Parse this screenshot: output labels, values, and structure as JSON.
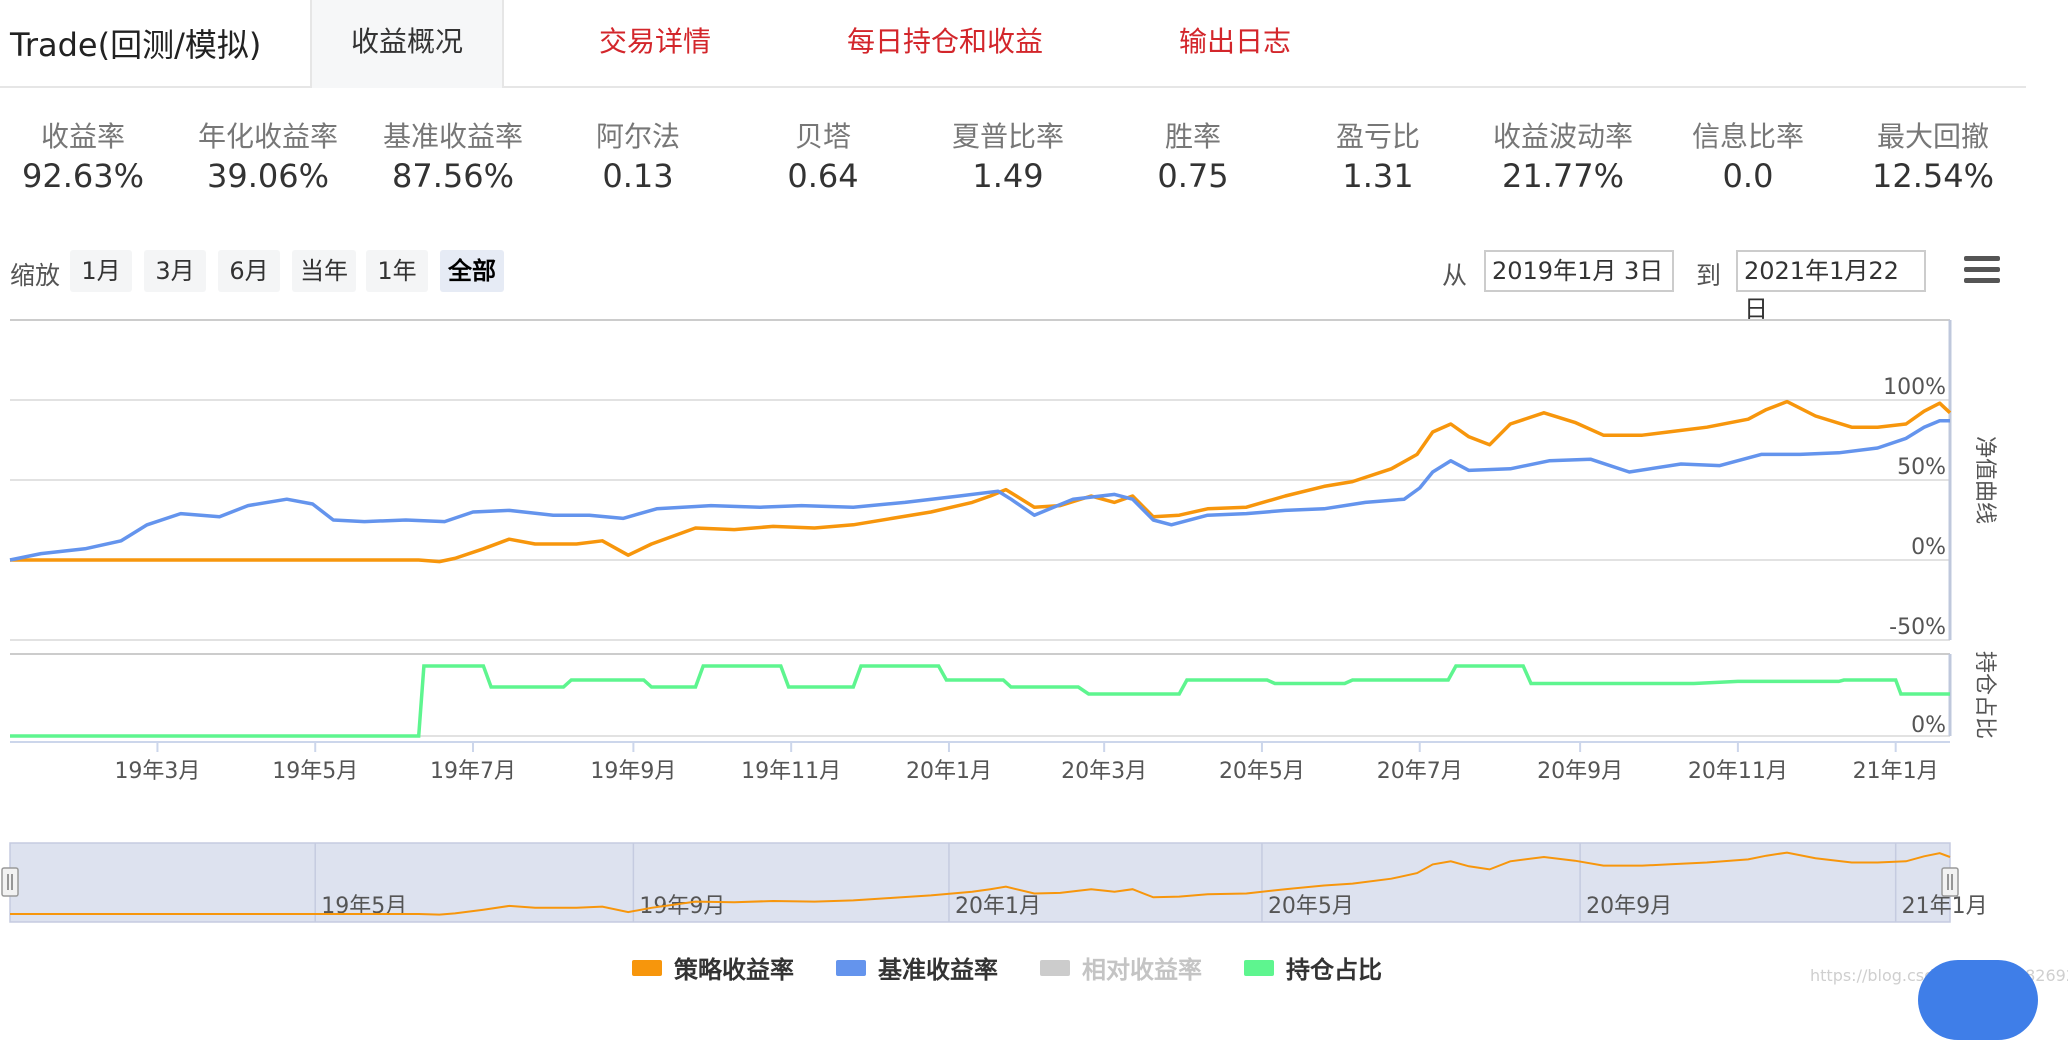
{
  "app_title": "Trade(回测/模拟)",
  "tabs": [
    {
      "label": "收益概况",
      "active": true
    },
    {
      "label": "交易详情",
      "active": false
    },
    {
      "label": "每日持仓和收益",
      "active": false
    },
    {
      "label": "输出日志",
      "active": false
    }
  ],
  "metrics": [
    {
      "label": "收益率",
      "value": "92.63%"
    },
    {
      "label": "年化收益率",
      "value": "39.06%"
    },
    {
      "label": "基准收益率",
      "value": "87.56%"
    },
    {
      "label": "阿尔法",
      "value": "0.13"
    },
    {
      "label": "贝塔",
      "value": "0.64"
    },
    {
      "label": "夏普比率",
      "value": "1.49"
    },
    {
      "label": "胜率",
      "value": "0.75"
    },
    {
      "label": "盈亏比",
      "value": "1.31"
    },
    {
      "label": "收益波动率",
      "value": "21.77%"
    },
    {
      "label": "信息比率",
      "value": "0.0"
    },
    {
      "label": "最大回撤",
      "value": "12.54%"
    }
  ],
  "zoom": {
    "label": "缩放",
    "buttons": [
      "1月",
      "3月",
      "6月",
      "当年",
      "1年",
      "全部"
    ],
    "selected": "全部"
  },
  "range": {
    "from_label": "从",
    "from": "2019年1月 3日",
    "to_label": "到",
    "to": "2021年1月22日"
  },
  "colors": {
    "strategy": "#f7960c",
    "benchmark": "#6494ed",
    "relative": "#cccccc",
    "position": "#5ef58f",
    "tab_link": "#d3262b"
  },
  "watermark": "https://blog.csdn.net/m0_58269290",
  "chart_data": {
    "type": "line",
    "x_range": [
      "2019-01-03",
      "2021-01-22"
    ],
    "x_ticks": [
      {
        "date": "2019-03-01",
        "label": "19年3月"
      },
      {
        "date": "2019-05-01",
        "label": "19年5月"
      },
      {
        "date": "2019-07-01",
        "label": "19年7月"
      },
      {
        "date": "2019-09-01",
        "label": "19年9月"
      },
      {
        "date": "2019-11-01",
        "label": "19年11月"
      },
      {
        "date": "2020-01-01",
        "label": "20年1月"
      },
      {
        "date": "2020-03-01",
        "label": "20年3月"
      },
      {
        "date": "2020-05-01",
        "label": "20年5月"
      },
      {
        "date": "2020-07-01",
        "label": "20年7月"
      },
      {
        "date": "2020-09-01",
        "label": "20年9月"
      },
      {
        "date": "2020-11-01",
        "label": "20年11月"
      },
      {
        "date": "2021-01-01",
        "label": "21年1月"
      }
    ],
    "navigator_ticks": [
      {
        "date": "2019-05-01",
        "label": "19年5月"
      },
      {
        "date": "2019-09-01",
        "label": "19年9月"
      },
      {
        "date": "2020-01-01",
        "label": "20年1月"
      },
      {
        "date": "2020-05-01",
        "label": "20年5月"
      },
      {
        "date": "2020-09-01",
        "label": "20年9月"
      },
      {
        "date": "2021-01-01",
        "label": "21年1月"
      }
    ],
    "navigator_handles": [
      "2019-01-03",
      "2021-01-22"
    ],
    "main_panel": {
      "ylabel": "净值曲线",
      "ylim": [
        -50,
        150
      ],
      "yticks": [
        {
          "v": 100,
          "label": "100%"
        },
        {
          "v": 50,
          "label": "50%"
        },
        {
          "v": 0,
          "label": "0%"
        },
        {
          "v": -50,
          "label": "-50%"
        }
      ],
      "series": [
        {
          "name": "策略收益率",
          "color_key": "strategy",
          "points": [
            [
              "2019-01-03",
              0
            ],
            [
              "2019-02-15",
              0
            ],
            [
              "2019-04-01",
              0
            ],
            [
              "2019-06-10",
              0
            ],
            [
              "2019-06-18",
              -1
            ],
            [
              "2019-06-24",
              1
            ],
            [
              "2019-07-05",
              7
            ],
            [
              "2019-07-15",
              13
            ],
            [
              "2019-07-25",
              10
            ],
            [
              "2019-08-10",
              10
            ],
            [
              "2019-08-20",
              12
            ],
            [
              "2019-08-30",
              3
            ],
            [
              "2019-09-08",
              10
            ],
            [
              "2019-09-25",
              20
            ],
            [
              "2019-10-10",
              19
            ],
            [
              "2019-10-25",
              21
            ],
            [
              "2019-11-10",
              20
            ],
            [
              "2019-11-25",
              22
            ],
            [
              "2019-12-10",
              26
            ],
            [
              "2019-12-25",
              30
            ],
            [
              "2020-01-10",
              36
            ],
            [
              "2020-01-17",
              40
            ],
            [
              "2020-01-23",
              44
            ],
            [
              "2020-02-03",
              33
            ],
            [
              "2020-02-13",
              34
            ],
            [
              "2020-02-25",
              40
            ],
            [
              "2020-03-05",
              36
            ],
            [
              "2020-03-12",
              40
            ],
            [
              "2020-03-20",
              27
            ],
            [
              "2020-03-30",
              28
            ],
            [
              "2020-04-10",
              32
            ],
            [
              "2020-04-25",
              33
            ],
            [
              "2020-05-10",
              40
            ],
            [
              "2020-05-25",
              46
            ],
            [
              "2020-06-05",
              49
            ],
            [
              "2020-06-20",
              57
            ],
            [
              "2020-06-30",
              66
            ],
            [
              "2020-07-06",
              80
            ],
            [
              "2020-07-13",
              85
            ],
            [
              "2020-07-20",
              77
            ],
            [
              "2020-07-28",
              72
            ],
            [
              "2020-08-05",
              85
            ],
            [
              "2020-08-18",
              92
            ],
            [
              "2020-08-30",
              86
            ],
            [
              "2020-09-10",
              78
            ],
            [
              "2020-09-25",
              78
            ],
            [
              "2020-10-05",
              80
            ],
            [
              "2020-10-20",
              83
            ],
            [
              "2020-11-05",
              88
            ],
            [
              "2020-11-12",
              94
            ],
            [
              "2020-11-20",
              99
            ],
            [
              "2020-12-01",
              90
            ],
            [
              "2020-12-15",
              83
            ],
            [
              "2020-12-25",
              83
            ],
            [
              "2021-01-05",
              85
            ],
            [
              "2021-01-12",
              93
            ],
            [
              "2021-01-18",
              98
            ],
            [
              "2021-01-22",
              92
            ]
          ]
        },
        {
          "name": "基准收益率",
          "color_key": "benchmark",
          "points": [
            [
              "2019-01-03",
              0
            ],
            [
              "2019-01-15",
              4
            ],
            [
              "2019-02-01",
              7
            ],
            [
              "2019-02-15",
              12
            ],
            [
              "2019-02-25",
              22
            ],
            [
              "2019-03-10",
              29
            ],
            [
              "2019-03-25",
              27
            ],
            [
              "2019-04-05",
              34
            ],
            [
              "2019-04-20",
              38
            ],
            [
              "2019-04-30",
              35
            ],
            [
              "2019-05-08",
              25
            ],
            [
              "2019-05-20",
              24
            ],
            [
              "2019-06-05",
              25
            ],
            [
              "2019-06-20",
              24
            ],
            [
              "2019-07-01",
              30
            ],
            [
              "2019-07-15",
              31
            ],
            [
              "2019-08-01",
              28
            ],
            [
              "2019-08-15",
              28
            ],
            [
              "2019-08-28",
              26
            ],
            [
              "2019-09-10",
              32
            ],
            [
              "2019-10-01",
              34
            ],
            [
              "2019-10-20",
              33
            ],
            [
              "2019-11-05",
              34
            ],
            [
              "2019-11-25",
              33
            ],
            [
              "2019-12-15",
              36
            ],
            [
              "2020-01-05",
              40
            ],
            [
              "2020-01-20",
              43
            ],
            [
              "2020-01-25",
              38
            ],
            [
              "2020-02-03",
              28
            ],
            [
              "2020-02-18",
              38
            ],
            [
              "2020-03-05",
              41
            ],
            [
              "2020-03-12",
              38
            ],
            [
              "2020-03-20",
              25
            ],
            [
              "2020-03-27",
              22
            ],
            [
              "2020-04-10",
              28
            ],
            [
              "2020-04-25",
              29
            ],
            [
              "2020-05-10",
              31
            ],
            [
              "2020-05-25",
              32
            ],
            [
              "2020-06-10",
              36
            ],
            [
              "2020-06-25",
              38
            ],
            [
              "2020-07-01",
              45
            ],
            [
              "2020-07-06",
              55
            ],
            [
              "2020-07-13",
              62
            ],
            [
              "2020-07-20",
              56
            ],
            [
              "2020-08-05",
              57
            ],
            [
              "2020-08-20",
              62
            ],
            [
              "2020-09-05",
              63
            ],
            [
              "2020-09-20",
              55
            ],
            [
              "2020-10-10",
              60
            ],
            [
              "2020-10-25",
              59
            ],
            [
              "2020-11-10",
              66
            ],
            [
              "2020-11-25",
              66
            ],
            [
              "2020-12-10",
              67
            ],
            [
              "2020-12-25",
              70
            ],
            [
              "2021-01-05",
              76
            ],
            [
              "2021-01-12",
              83
            ],
            [
              "2021-01-18",
              87
            ],
            [
              "2021-01-22",
              87
            ]
          ]
        }
      ]
    },
    "position_panel": {
      "ylabel": "持仓占比",
      "ytick_label": "0%",
      "series": {
        "name": "持仓占比",
        "color_key": "position",
        "points": [
          [
            "2019-01-03",
            0
          ],
          [
            "2019-06-10",
            0
          ],
          [
            "2019-06-12",
            100
          ],
          [
            "2019-07-05",
            100
          ],
          [
            "2019-07-08",
            70
          ],
          [
            "2019-08-05",
            70
          ],
          [
            "2019-08-08",
            80
          ],
          [
            "2019-09-05",
            80
          ],
          [
            "2019-09-08",
            70
          ],
          [
            "2019-09-25",
            70
          ],
          [
            "2019-09-28",
            100
          ],
          [
            "2019-10-28",
            100
          ],
          [
            "2019-10-31",
            70
          ],
          [
            "2019-11-25",
            70
          ],
          [
            "2019-11-28",
            100
          ],
          [
            "2019-12-28",
            100
          ],
          [
            "2019-12-31",
            80
          ],
          [
            "2020-01-22",
            80
          ],
          [
            "2020-01-25",
            70
          ],
          [
            "2020-02-20",
            70
          ],
          [
            "2020-02-24",
            60
          ],
          [
            "2020-03-30",
            60
          ],
          [
            "2020-04-02",
            80
          ],
          [
            "2020-05-03",
            80
          ],
          [
            "2020-05-06",
            75
          ],
          [
            "2020-06-02",
            75
          ],
          [
            "2020-06-05",
            80
          ],
          [
            "2020-07-12",
            80
          ],
          [
            "2020-07-15",
            100
          ],
          [
            "2020-08-10",
            100
          ],
          [
            "2020-08-13",
            75
          ],
          [
            "2020-10-15",
            75
          ],
          [
            "2020-11-01",
            78
          ],
          [
            "2020-12-10",
            78
          ],
          [
            "2020-12-12",
            80
          ],
          [
            "2021-01-01",
            80
          ],
          [
            "2021-01-03",
            60
          ],
          [
            "2021-01-22",
            60
          ]
        ]
      }
    },
    "legend": [
      {
        "name": "策略收益率",
        "color_key": "strategy",
        "enabled": true
      },
      {
        "name": "基准收益率",
        "color_key": "benchmark",
        "enabled": true
      },
      {
        "name": "相对收益率",
        "color_key": "relative",
        "enabled": false
      },
      {
        "name": "持仓占比",
        "color_key": "position",
        "enabled": true
      }
    ]
  }
}
